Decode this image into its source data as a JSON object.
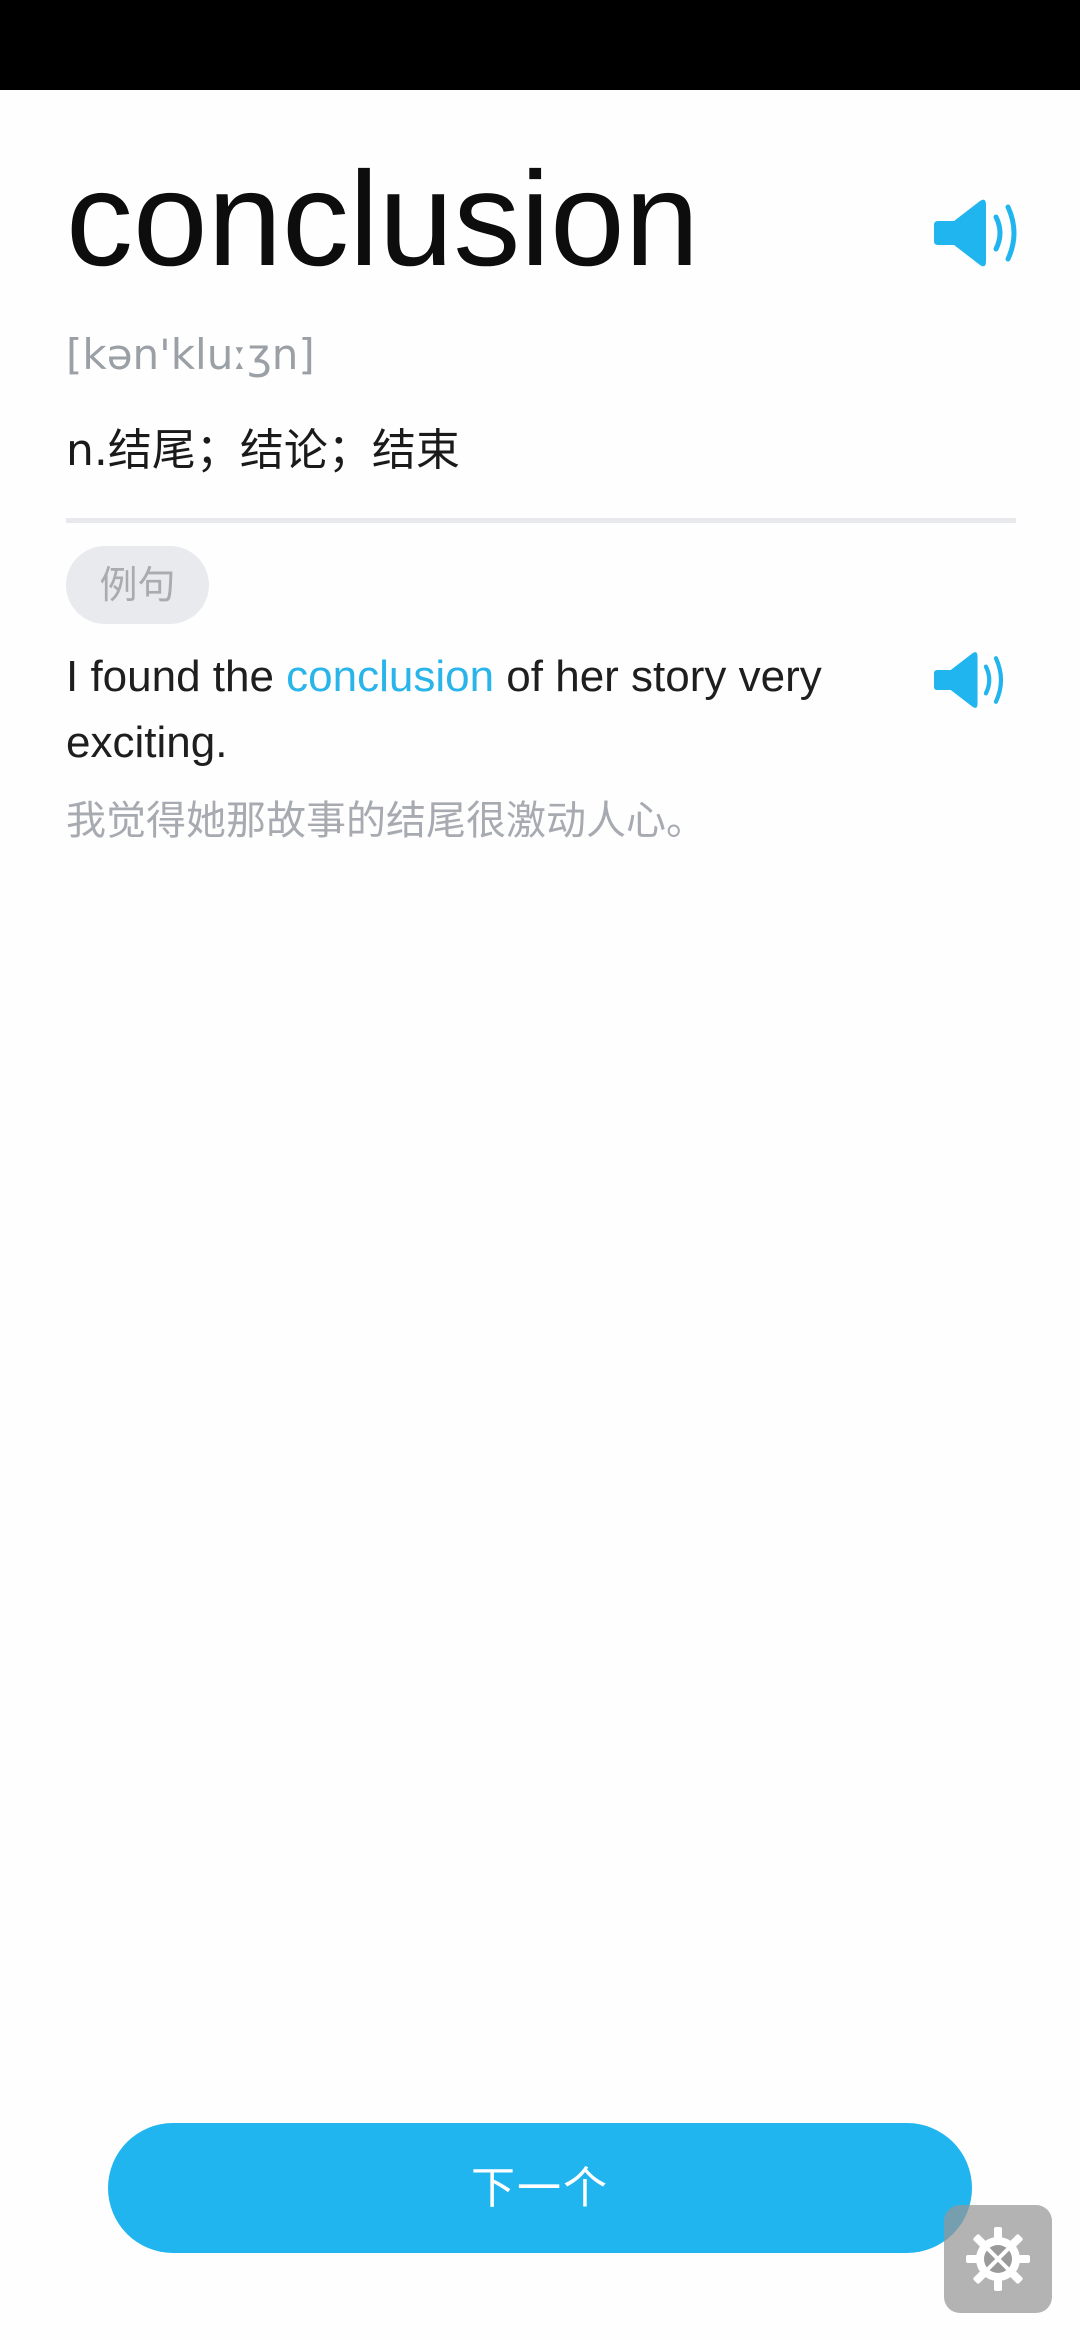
{
  "word": {
    "text": "conclusion",
    "phonetic": "[kən'kluːʒn]",
    "definition": "n.结尾；结论；结束",
    "speaker_icon": "speaker-icon"
  },
  "example": {
    "tag_label": "例句",
    "sentence_before": "I found the ",
    "sentence_highlight": "conclusion",
    "sentence_after": " of her story very exciting.",
    "translation": "我觉得她那故事的结尾很激动人心。",
    "speaker_icon": "speaker-icon"
  },
  "footer": {
    "next_label": "下一个",
    "settings_icon": "settings-tools-icon"
  },
  "colors": {
    "accent": "#21b5ef",
    "highlight": "#29b4ea",
    "muted_text": "#a7abb1",
    "divider": "#e8e9ec",
    "tag_bg": "#e9eaed",
    "status_bar": "#000000"
  }
}
